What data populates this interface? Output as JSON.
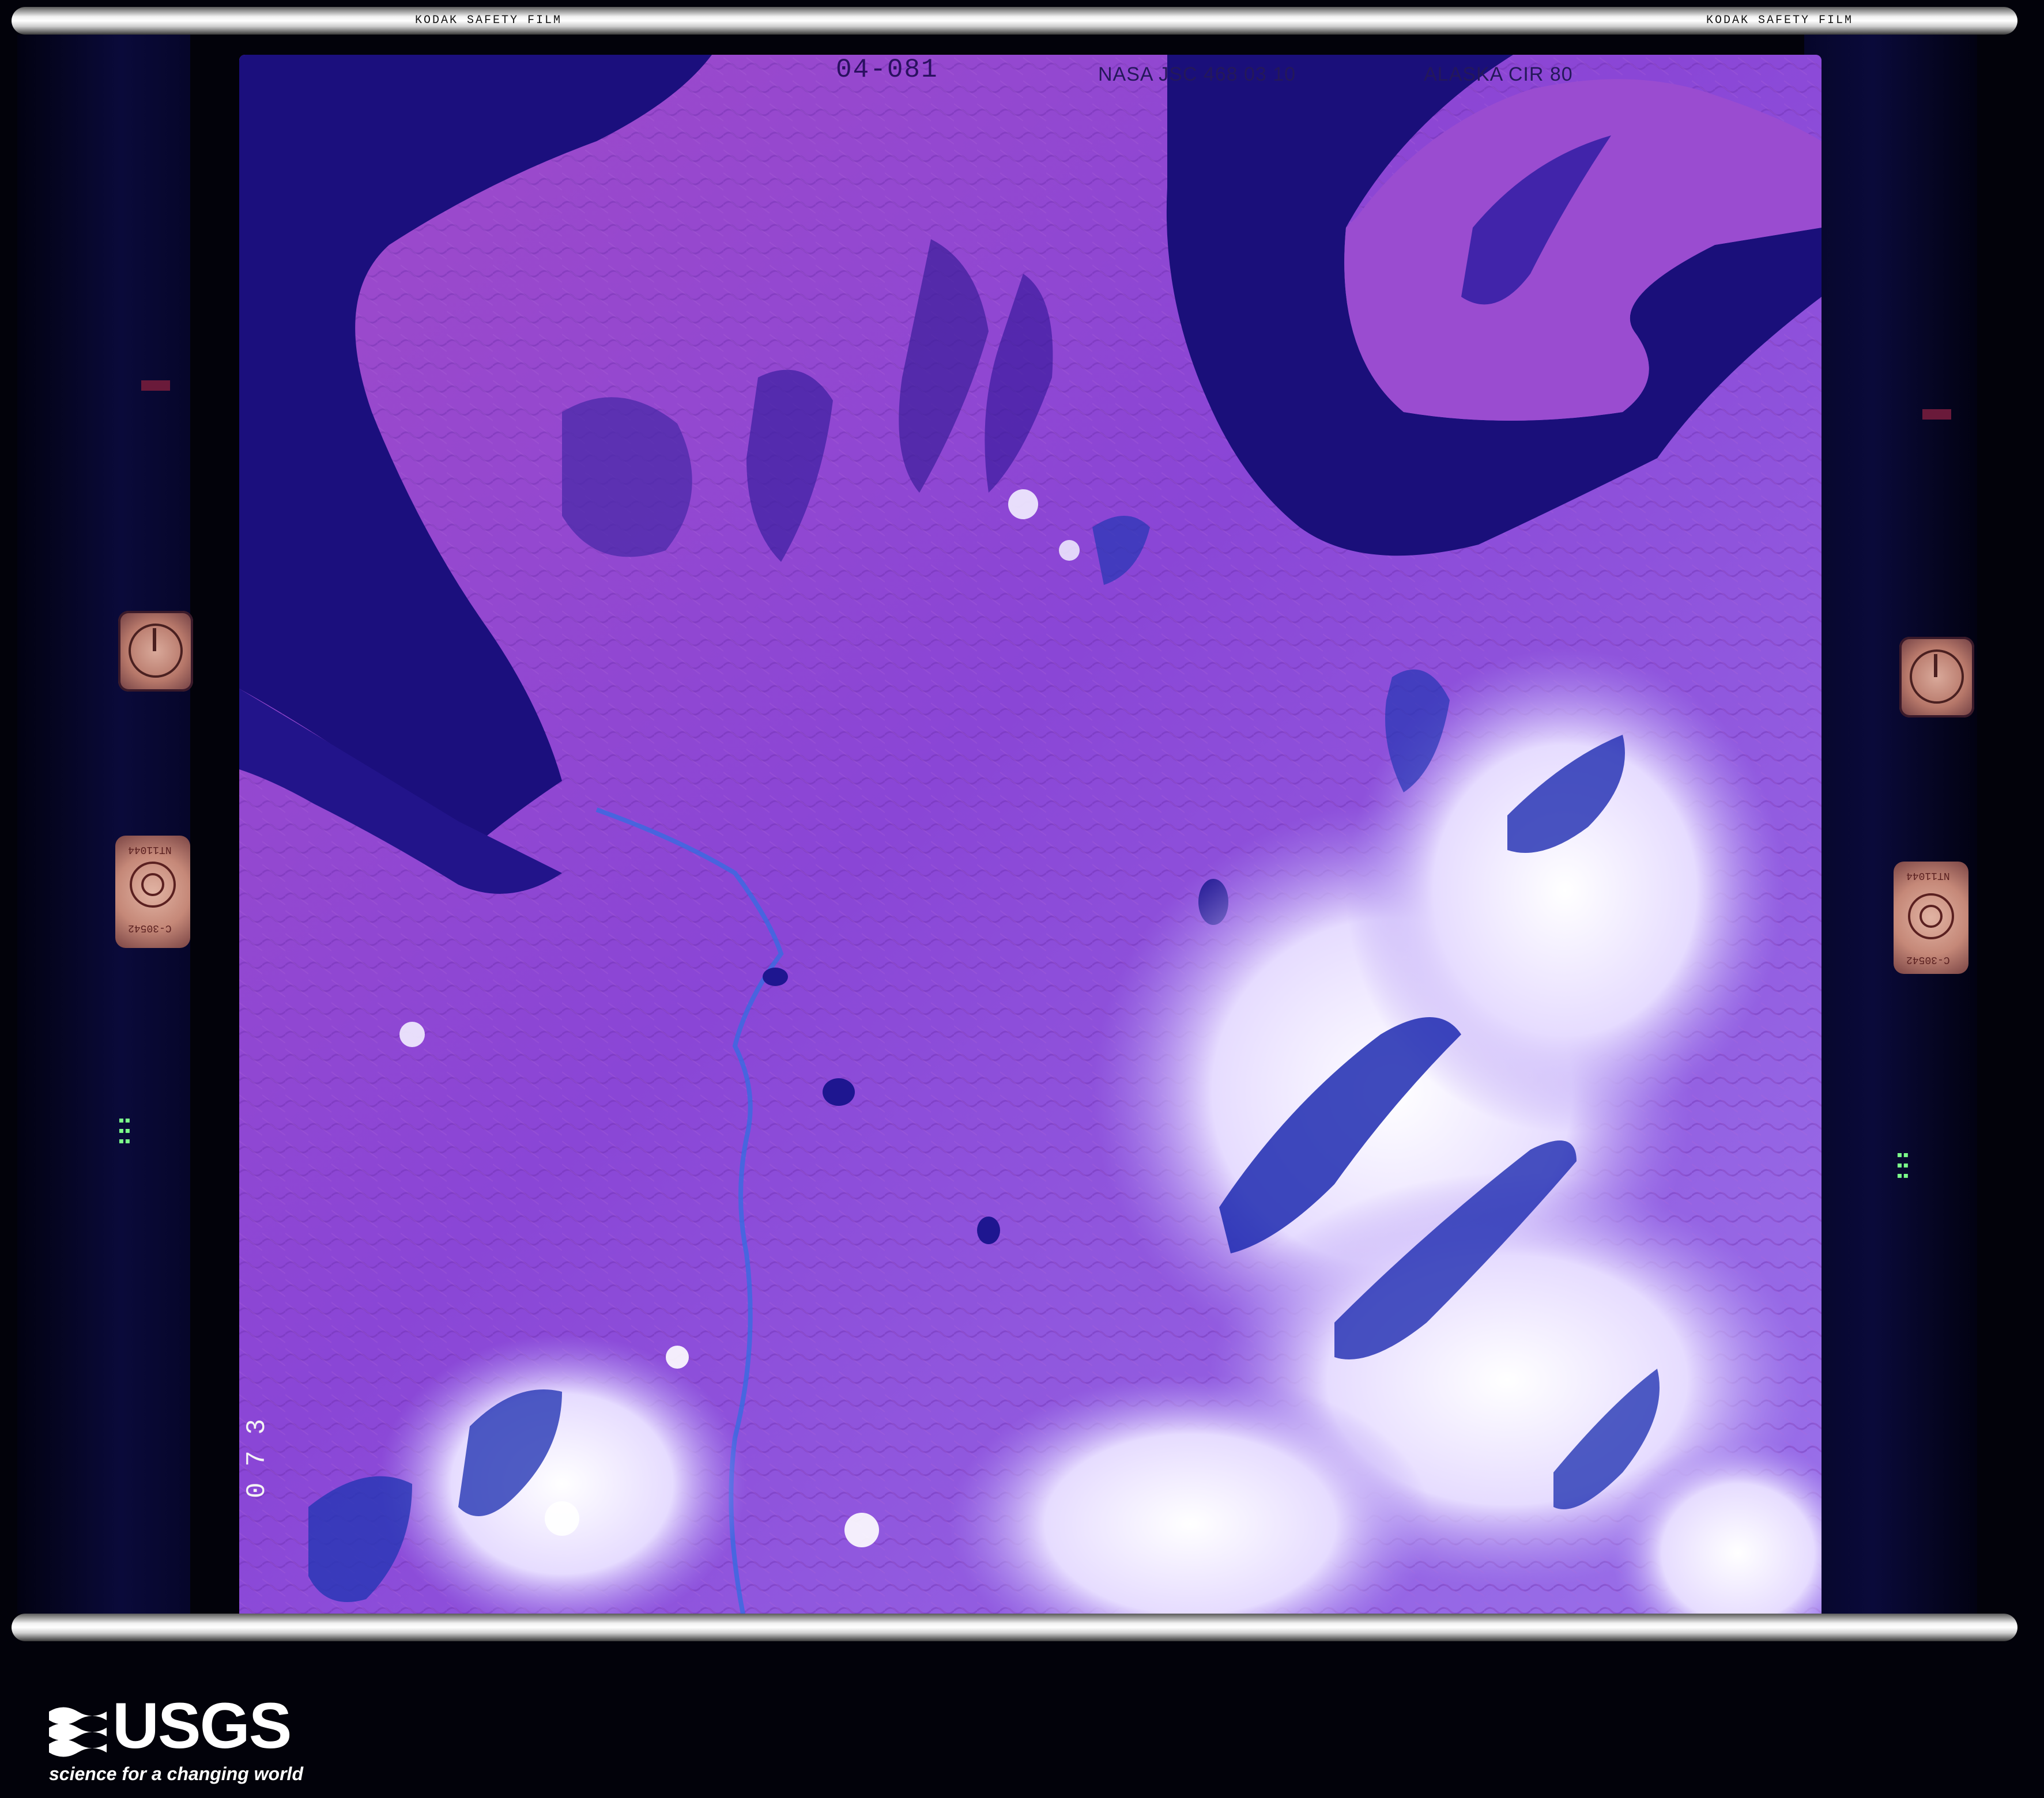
{
  "film": {
    "edge_label_top": "KODAK SAFETY FILM",
    "edge_label_top_right": "KODAK SAFETY FILM"
  },
  "frame": {
    "mission_id": "04-081",
    "agency_meta": "NASA JSC 468 03 10",
    "region_label": "ALASKA CIR 80",
    "frame_number": "0 7 3"
  },
  "fiducials": {
    "left_target_code_top": "NT11044",
    "left_target_code_bottom": "C-30542",
    "right_target_code_top": "NT11044",
    "right_target_code_bottom": "C-30542"
  },
  "logo": {
    "wordmark": "USGS",
    "tagline": "science for a changing world"
  },
  "colors": {
    "land": "#8a45d8",
    "water": "#1a0f7a",
    "snow": "#f2f0ff",
    "film_base": "#02020a"
  }
}
